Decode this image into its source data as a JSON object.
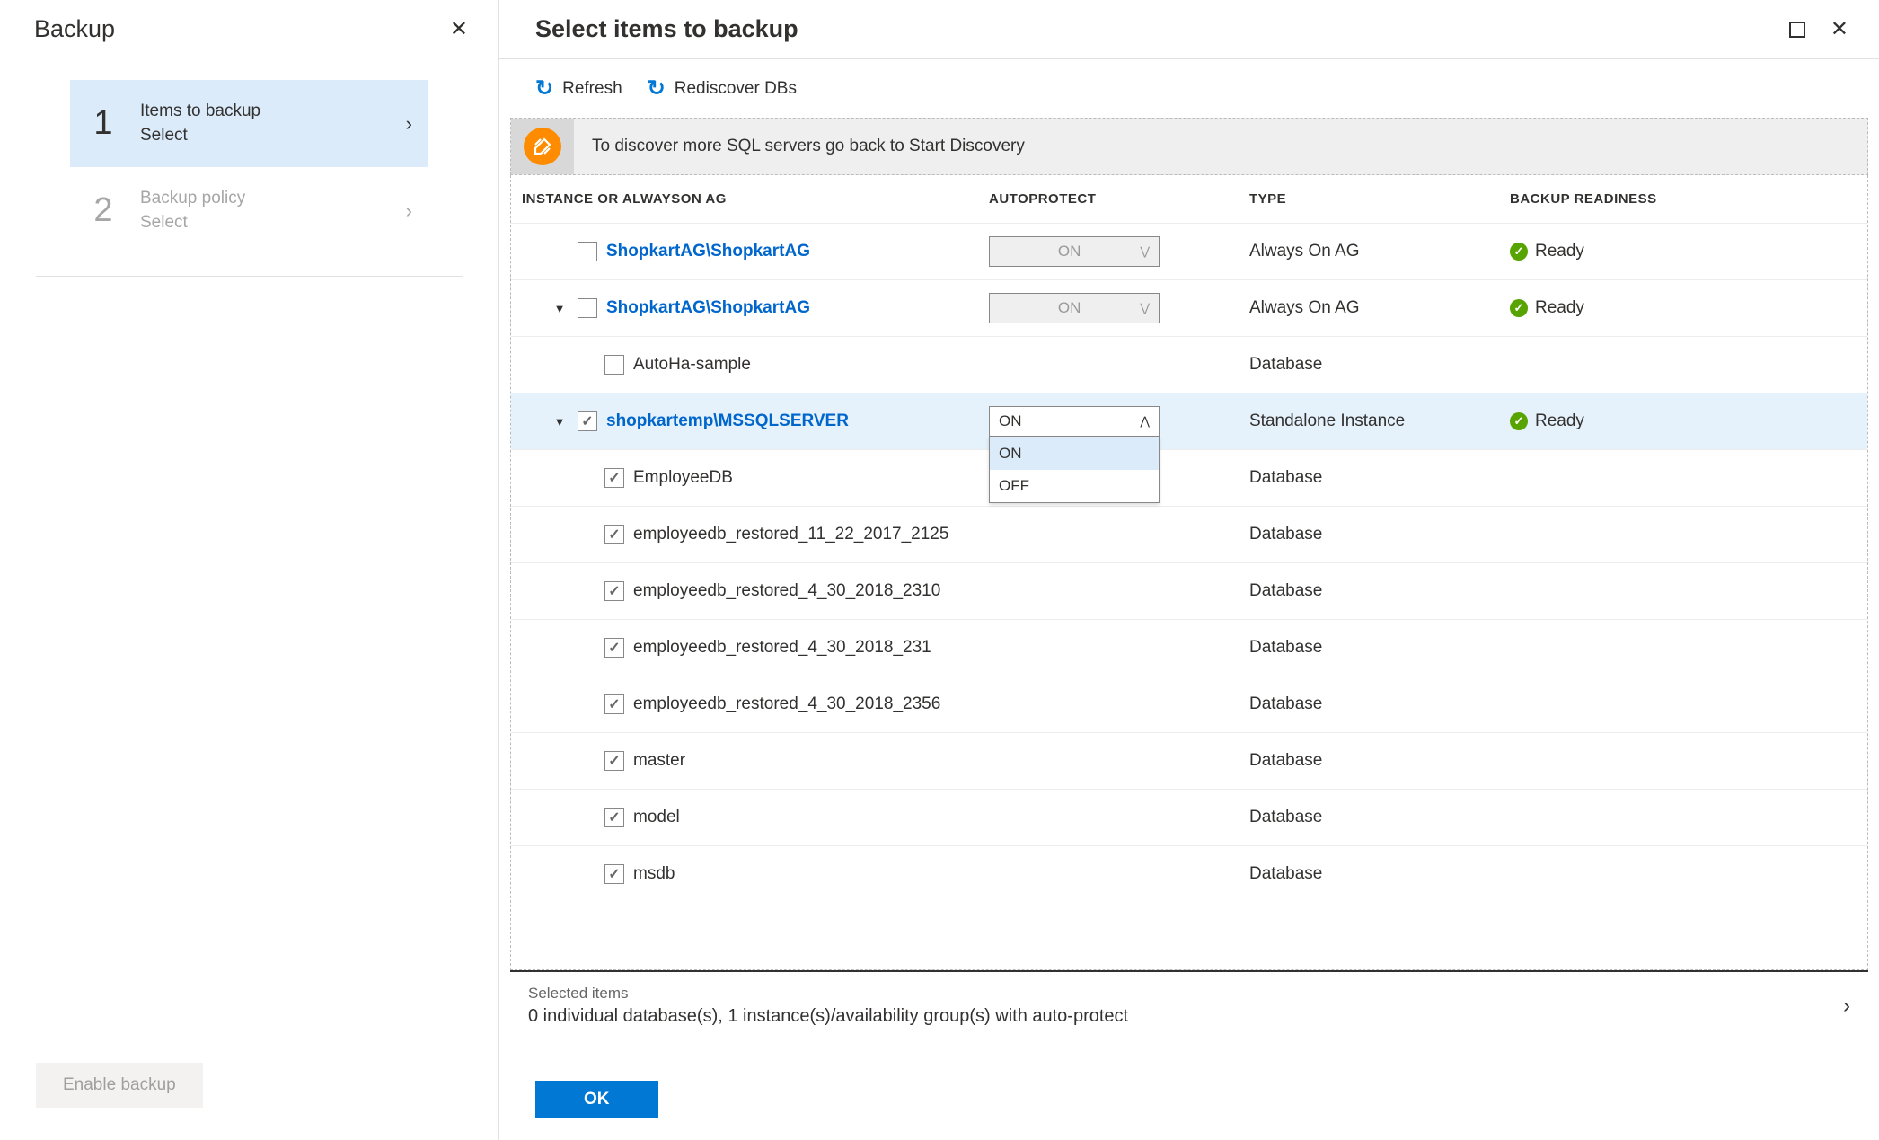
{
  "left": {
    "title": "Backup",
    "steps": [
      {
        "num": "1",
        "title": "Items to backup",
        "sub": "Select",
        "active": true
      },
      {
        "num": "2",
        "title": "Backup policy",
        "sub": "Select",
        "active": false
      }
    ],
    "footer_button": "Enable backup"
  },
  "right": {
    "title": "Select items to backup",
    "toolbar": {
      "refresh": "Refresh",
      "rediscover": "Rediscover DBs"
    },
    "banner": "To discover more SQL servers go back to Start Discovery",
    "columns": {
      "instance": "INSTANCE OR ALWAYSON AG",
      "autoprotect": "AUTOPROTECT",
      "type": "TYPE",
      "readiness": "BACKUP READINESS"
    },
    "autoprotect_options": {
      "on": "ON",
      "off": "OFF"
    },
    "rows": [
      {
        "indent": 0,
        "expander": "",
        "checked": false,
        "link": true,
        "name": "ShopkartAG\\ShopkartAG",
        "autoprotect": "ON",
        "ap_disabled": true,
        "ap_open": false,
        "type": "Always On AG",
        "ready": "Ready",
        "selected": false
      },
      {
        "indent": 0,
        "expander": "▼",
        "checked": false,
        "link": true,
        "name": "ShopkartAG\\ShopkartAG",
        "autoprotect": "ON",
        "ap_disabled": true,
        "ap_open": false,
        "type": "Always On AG",
        "ready": "Ready",
        "selected": false
      },
      {
        "indent": 1,
        "expander": "",
        "checked": false,
        "link": false,
        "name": "AutoHa-sample",
        "autoprotect": "",
        "ap_disabled": false,
        "ap_open": false,
        "type": "Database",
        "ready": "",
        "selected": false
      },
      {
        "indent": 0,
        "expander": "▼",
        "checked": true,
        "link": true,
        "name": "shopkartemp\\MSSQLSERVER",
        "autoprotect": "ON",
        "ap_disabled": false,
        "ap_open": true,
        "type": "Standalone Instance",
        "ready": "Ready",
        "selected": true
      },
      {
        "indent": 1,
        "expander": "",
        "checked": true,
        "link": false,
        "name": "EmployeeDB",
        "autoprotect": "",
        "ap_disabled": false,
        "ap_open": false,
        "type": "Database",
        "ready": "",
        "selected": false
      },
      {
        "indent": 1,
        "expander": "",
        "checked": true,
        "link": false,
        "name": "employeedb_restored_11_22_2017_2125",
        "autoprotect": "",
        "ap_disabled": false,
        "ap_open": false,
        "type": "Database",
        "ready": "",
        "selected": false
      },
      {
        "indent": 1,
        "expander": "",
        "checked": true,
        "link": false,
        "name": "employeedb_restored_4_30_2018_2310",
        "autoprotect": "",
        "ap_disabled": false,
        "ap_open": false,
        "type": "Database",
        "ready": "",
        "selected": false
      },
      {
        "indent": 1,
        "expander": "",
        "checked": true,
        "link": false,
        "name": "employeedb_restored_4_30_2018_231",
        "autoprotect": "",
        "ap_disabled": false,
        "ap_open": false,
        "type": "Database",
        "ready": "",
        "selected": false
      },
      {
        "indent": 1,
        "expander": "",
        "checked": true,
        "link": false,
        "name": "employeedb_restored_4_30_2018_2356",
        "autoprotect": "",
        "ap_disabled": false,
        "ap_open": false,
        "type": "Database",
        "ready": "",
        "selected": false
      },
      {
        "indent": 1,
        "expander": "",
        "checked": true,
        "link": false,
        "name": "master",
        "autoprotect": "",
        "ap_disabled": false,
        "ap_open": false,
        "type": "Database",
        "ready": "",
        "selected": false
      },
      {
        "indent": 1,
        "expander": "",
        "checked": true,
        "link": false,
        "name": "model",
        "autoprotect": "",
        "ap_disabled": false,
        "ap_open": false,
        "type": "Database",
        "ready": "",
        "selected": false
      },
      {
        "indent": 1,
        "expander": "",
        "checked": true,
        "link": false,
        "name": "msdb",
        "autoprotect": "",
        "ap_disabled": false,
        "ap_open": false,
        "type": "Database",
        "ready": "",
        "selected": false
      }
    ],
    "summary": {
      "title": "Selected items",
      "value": "0 individual database(s), 1 instance(s)/availability group(s) with auto-protect"
    },
    "ok_button": "OK"
  }
}
